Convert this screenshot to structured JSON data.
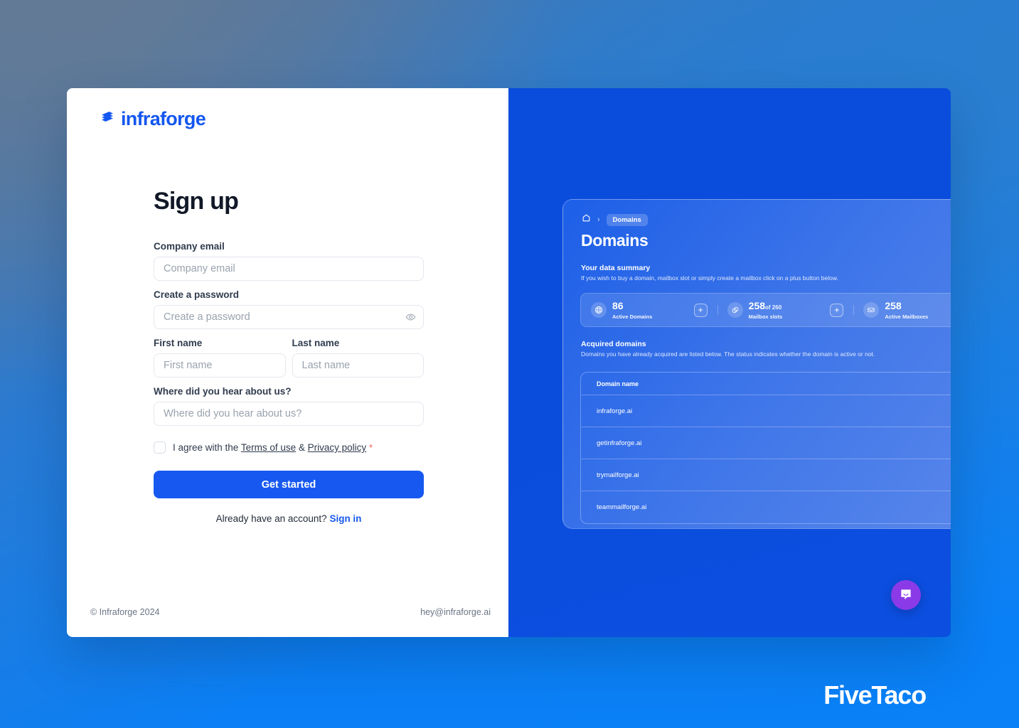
{
  "brand": {
    "name": "infraforge",
    "logo_icon": "infraforge-mark-icon",
    "accent_color": "#1759f0"
  },
  "signup": {
    "title": "Sign up",
    "fields": {
      "email": {
        "label": "Company email",
        "placeholder": "Company email",
        "value": ""
      },
      "password": {
        "label": "Create a password",
        "placeholder": "Create a password",
        "value": "",
        "toggle_icon": "eye-icon"
      },
      "first_name": {
        "label": "First name",
        "placeholder": "First name",
        "value": ""
      },
      "last_name": {
        "label": "Last name",
        "placeholder": "Last name",
        "value": ""
      },
      "referral": {
        "label": "Where did you hear about us?",
        "placeholder": "Where did you hear about us?",
        "value": ""
      }
    },
    "agreement": {
      "prefix": "I agree with the",
      "terms_link": "Terms of use",
      "conjunction": "&",
      "privacy_link": "Privacy policy",
      "required_marker": "*",
      "checked": false
    },
    "submit_label": "Get started",
    "signin_prompt": "Already have an account?",
    "signin_link": "Sign in"
  },
  "footer": {
    "copyright": "© Infraforge 2024",
    "contact_email": "hey@infraforge.ai"
  },
  "preview": {
    "breadcrumb": {
      "home_icon": "home-icon",
      "separator": "›",
      "current": "Domains"
    },
    "title": "Domains",
    "summary": {
      "heading": "Your data summary",
      "description": "If you wish to buy a domain, mailbox slot or simply create a mailbox click on a plus button below."
    },
    "stats": [
      {
        "icon": "globe-icon",
        "value": "86",
        "suffix": "",
        "label": "Active Domains",
        "action_icon": "plus-icon"
      },
      {
        "icon": "mailbox-slots-icon",
        "value": "258",
        "suffix": "of 260",
        "label": "Mailbox slots",
        "action_icon": "plus-icon"
      },
      {
        "icon": "inbox-icon",
        "value": "258",
        "suffix": "",
        "label": "Active Mailboxes",
        "action_icon": "plus-icon"
      }
    ],
    "acquired": {
      "heading": "Acquired domains",
      "description": "Domains you have already acquired are listed below. The status indicates whether the domain is active or not."
    },
    "table": {
      "columns": [
        "Domain name"
      ],
      "rows": [
        [
          "infraforge.ai"
        ],
        [
          "getinfraforge.ai"
        ],
        [
          "trymailforge.ai"
        ],
        [
          "teammailforge.ai"
        ]
      ]
    }
  },
  "chat_widget": {
    "icon": "chat-bubble-icon",
    "color": "#8b3ae8"
  },
  "watermark": {
    "text": "FiveTaco"
  }
}
